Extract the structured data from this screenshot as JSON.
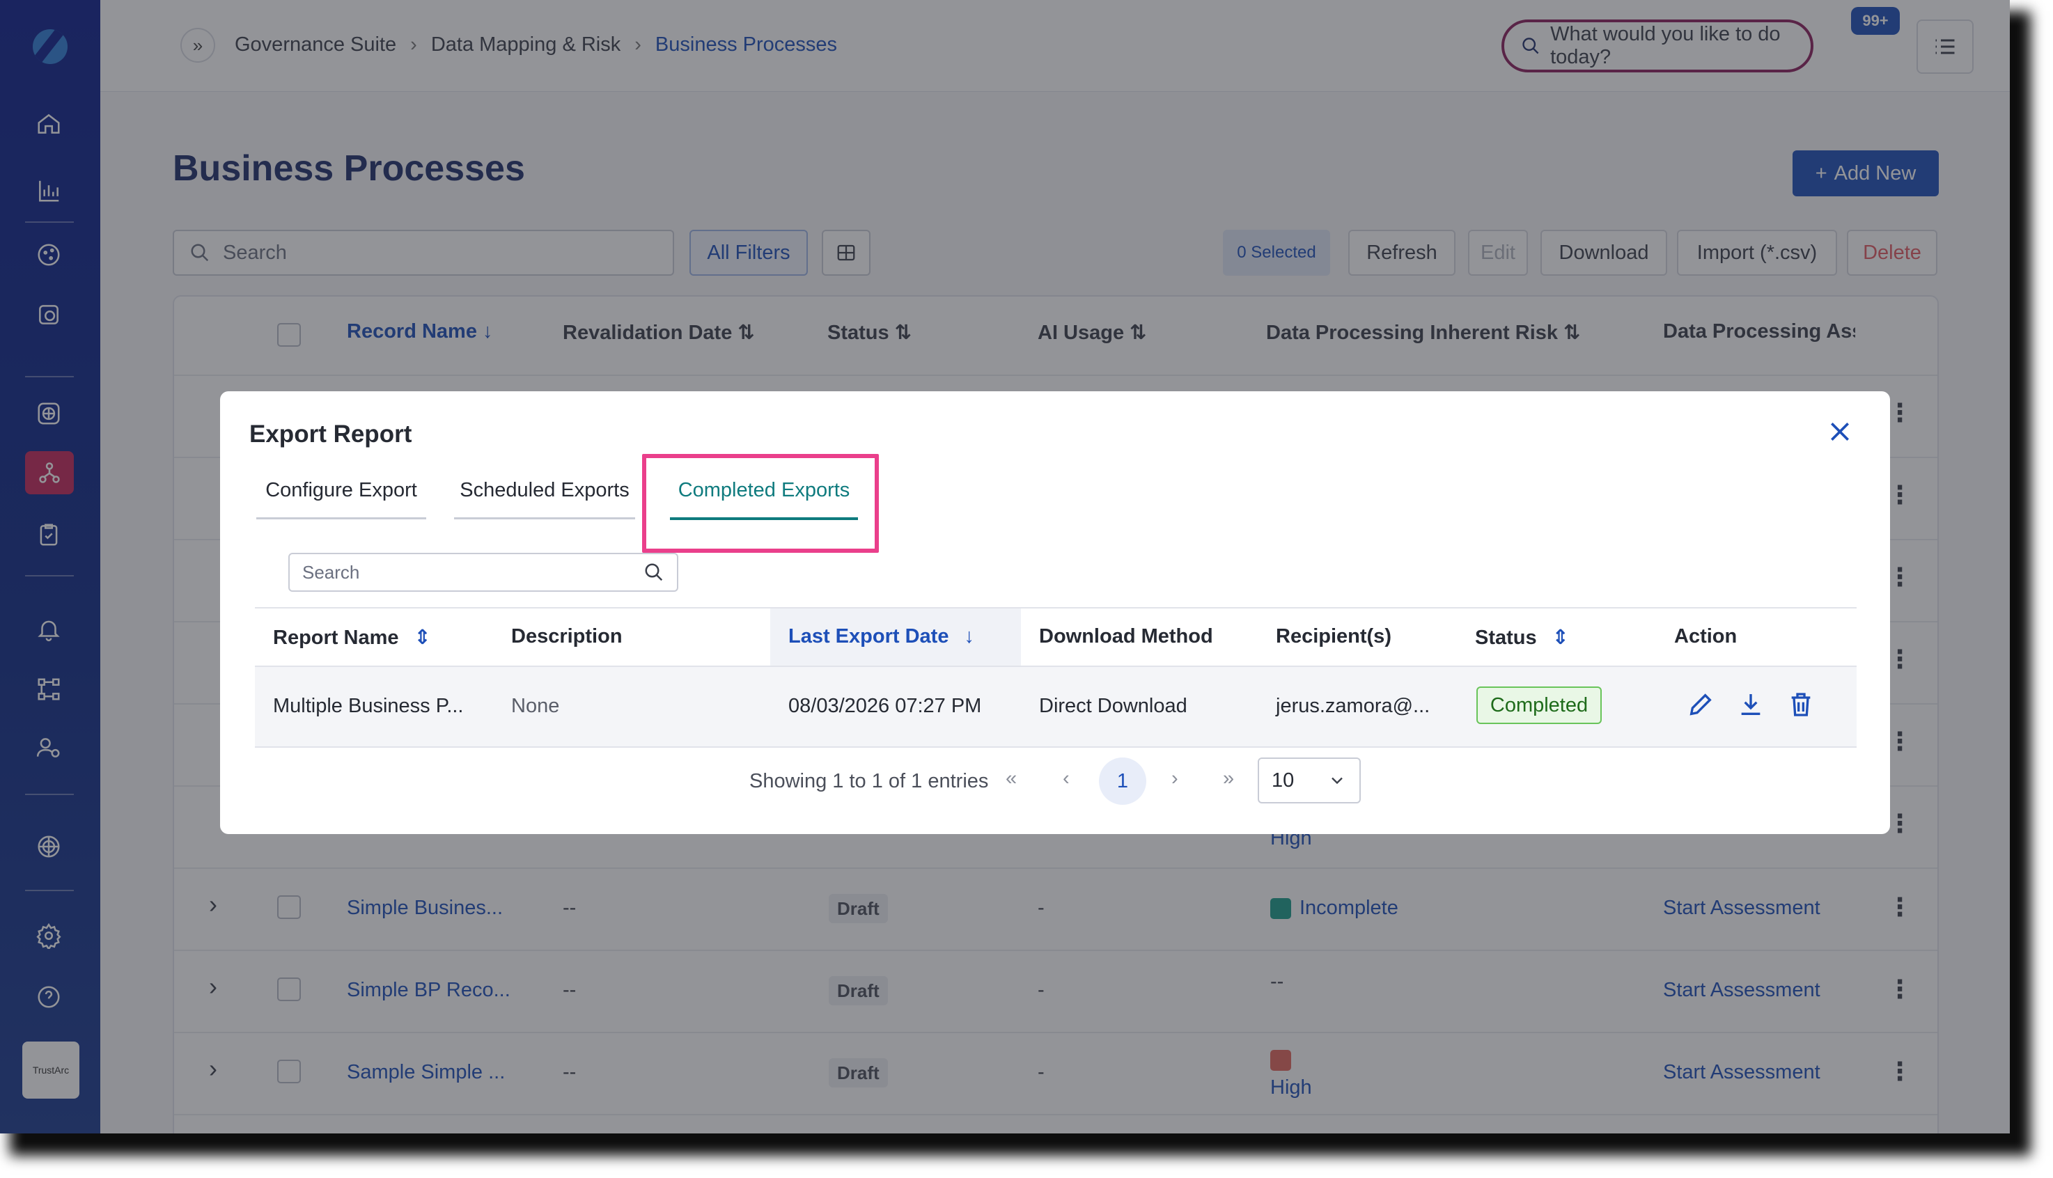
{
  "header": {
    "breadcrumbs": [
      "Governance Suite",
      "Data Mapping & Risk",
      "Business Processes"
    ],
    "ask_placeholder": "What would you like to do today?",
    "notification_count": "99+"
  },
  "sidebar": {
    "brand": "TrustArc",
    "icons": [
      "home-icon",
      "analytics-icon",
      "cookie-icon",
      "consent-icon",
      "globe-icon",
      "data-mapping-icon",
      "assessment-icon",
      "bell-icon",
      "workflow-icon",
      "user-settings-icon",
      "privacy-icon",
      "settings-icon",
      "help-icon"
    ]
  },
  "page": {
    "title": "Business Processes",
    "add_new": "Add New",
    "search_placeholder": "Search",
    "all_filters": "All Filters",
    "toolbar": {
      "selected": "0 Selected",
      "refresh": "Refresh",
      "edit": "Edit",
      "download": "Download",
      "import": "Import (*.csv)",
      "delete": "Delete"
    },
    "columns": [
      "Record Name",
      "Revalidation Date",
      "Status",
      "AI Usage",
      "Data Processing Inherent Risk",
      "Data Processing Ass"
    ],
    "rows": [
      {
        "name": "Simple Busines...",
        "revalidation": "--",
        "status": "Draft",
        "ai": "-",
        "risk": "Incomplete",
        "action": "Start Assessment"
      },
      {
        "name": "Simple BP Reco...",
        "revalidation": "--",
        "status": "Draft",
        "ai": "-",
        "risk": "--",
        "action": "Start Assessment"
      },
      {
        "name": "Sample Simple ...",
        "revalidation": "--",
        "status": "Draft",
        "ai": "-",
        "risk": "High",
        "action": "Start Assessment"
      }
    ],
    "partial_risk_above": "High"
  },
  "modal": {
    "title": "Export Report",
    "tabs": [
      "Configure Export",
      "Scheduled Exports",
      "Completed Exports"
    ],
    "active_tab": "Completed Exports",
    "search_placeholder": "Search",
    "columns": [
      "Report Name",
      "Description",
      "Last Export Date",
      "Download Method",
      "Recipient(s)",
      "Status",
      "Action"
    ],
    "rows": [
      {
        "report_name": "Multiple Business P...",
        "description": "None",
        "last_export_date": "08/03/2026 07:27 PM",
        "download_method": "Direct Download",
        "recipients": "jerus.zamora@...",
        "status": "Completed"
      }
    ],
    "pagination": {
      "summary": "Showing 1 to 1 of 1 entries",
      "current_page": "1",
      "per_page": "10"
    }
  },
  "colors": {
    "accent": "#1d4fb8",
    "highlight": "#ea3f8b",
    "active_tab": "#0f7b7e",
    "success": "#69c45a",
    "danger": "#e35b62"
  }
}
